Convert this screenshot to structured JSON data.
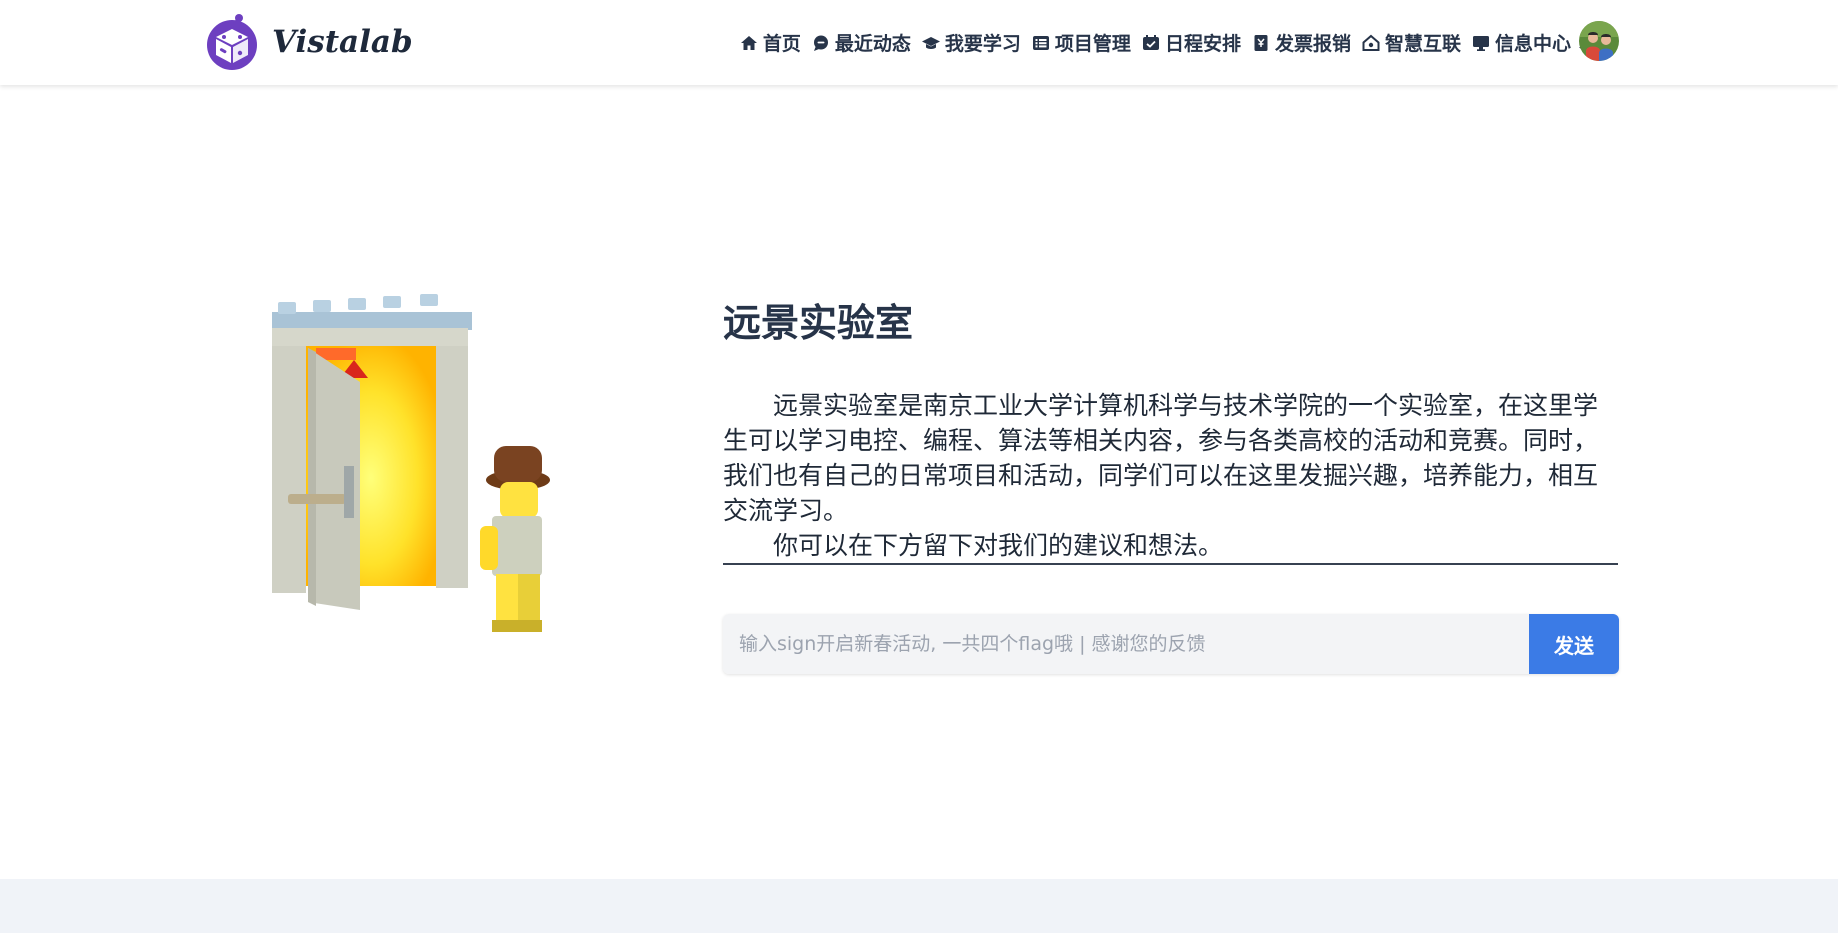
{
  "brand": {
    "name": "Vistalab"
  },
  "nav": {
    "items": [
      {
        "label": "首页",
        "icon": "home-icon"
      },
      {
        "label": "最近动态",
        "icon": "chat-bubble-icon"
      },
      {
        "label": "我要学习",
        "icon": "graduation-cap-icon"
      },
      {
        "label": "项目管理",
        "icon": "list-icon"
      },
      {
        "label": "日程安排",
        "icon": "calendar-check-icon"
      },
      {
        "label": "发票报销",
        "icon": "receipt-icon"
      },
      {
        "label": "智慧互联",
        "icon": "smart-home-icon"
      },
      {
        "label": "信息中心",
        "icon": "monitor-icon"
      }
    ]
  },
  "hero": {
    "title": "远景实验室",
    "paragraph1": "远景实验室是南京工业大学计算机科学与技术学院的一个实验室，在这里学生可以学习电控、编程、算法等相关内容，参与各类高校的活动和竞赛。同时，我们也有自己的日常项目和活动，同学们可以在这里发掘兴趣，培养能力，相互交流学习。",
    "paragraph2": "你可以在下方留下对我们的建议和想法。"
  },
  "feedback": {
    "placeholder": "输入sign开启新春活动, 一共四个flag哦 | 感谢您的反馈",
    "submit_label": "发送"
  },
  "colors": {
    "accent": "#3b7be6",
    "nav_text": "#273449",
    "footer_band": "#f0f3f8",
    "logo_purple": "#6d3fc0"
  }
}
